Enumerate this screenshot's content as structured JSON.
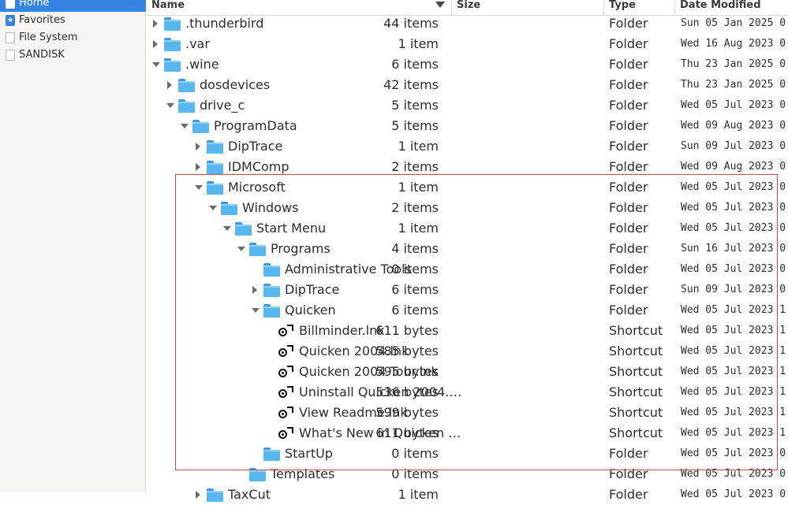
{
  "sidebar": {
    "items": [
      {
        "label": "Home",
        "icon": "home-icon",
        "selected": true
      },
      {
        "label": "Favorites",
        "icon": "star-icon",
        "selected": false
      },
      {
        "label": "File System",
        "icon": "drive-icon",
        "selected": false
      },
      {
        "label": "SANDISK",
        "icon": "drive-icon",
        "selected": false
      }
    ]
  },
  "columns": {
    "name": "Name",
    "size": "Size",
    "type": "Type",
    "date": "Date Modified"
  },
  "rows": [
    {
      "name": ".thunderbird",
      "size": "44 items",
      "type": "Folder",
      "date": "Sun 05 Jan 2025 0",
      "depth": 0,
      "expander": "collapsed",
      "icon": "folder-icon"
    },
    {
      "name": ".var",
      "size": "1 item",
      "type": "Folder",
      "date": "Wed 16 Aug 2023 0",
      "depth": 0,
      "expander": "collapsed",
      "icon": "folder-icon"
    },
    {
      "name": ".wine",
      "size": "6 items",
      "type": "Folder",
      "date": "Thu 23 Jan 2025 0",
      "depth": 0,
      "expander": "expanded",
      "icon": "folder-icon"
    },
    {
      "name": "dosdevices",
      "size": "42 items",
      "type": "Folder",
      "date": "Thu 23 Jan 2025 0",
      "depth": 1,
      "expander": "collapsed",
      "icon": "folder-icon"
    },
    {
      "name": "drive_c",
      "size": "5 items",
      "type": "Folder",
      "date": "Wed 05 Jul 2023 0",
      "depth": 1,
      "expander": "expanded",
      "icon": "folder-icon"
    },
    {
      "name": "ProgramData",
      "size": "5 items",
      "type": "Folder",
      "date": "Wed 09 Aug 2023 0",
      "depth": 2,
      "expander": "expanded",
      "icon": "folder-icon"
    },
    {
      "name": "DipTrace",
      "size": "1 item",
      "type": "Folder",
      "date": "Sun 09 Jul 2023 0",
      "depth": 3,
      "expander": "collapsed",
      "icon": "folder-icon"
    },
    {
      "name": "IDMComp",
      "size": "2 items",
      "type": "Folder",
      "date": "Wed 09 Aug 2023 0",
      "depth": 3,
      "expander": "collapsed",
      "icon": "folder-icon"
    },
    {
      "name": "Microsoft",
      "size": "1 item",
      "type": "Folder",
      "date": "Wed 05 Jul 2023 0",
      "depth": 3,
      "expander": "expanded",
      "icon": "folder-icon"
    },
    {
      "name": "Windows",
      "size": "2 items",
      "type": "Folder",
      "date": "Wed 05 Jul 2023 0",
      "depth": 4,
      "expander": "expanded",
      "icon": "folder-icon"
    },
    {
      "name": "Start Menu",
      "size": "1 item",
      "type": "Folder",
      "date": "Wed 05 Jul 2023 0",
      "depth": 5,
      "expander": "expanded",
      "icon": "folder-icon"
    },
    {
      "name": "Programs",
      "size": "4 items",
      "type": "Folder",
      "date": "Sun 16 Jul 2023 0",
      "depth": 6,
      "expander": "expanded",
      "icon": "folder-icon"
    },
    {
      "name": "Administrative Tools",
      "size": "0 items",
      "type": "Folder",
      "date": "Wed 05 Jul 2023 0",
      "depth": 7,
      "expander": "none",
      "icon": "folder-icon"
    },
    {
      "name": "DipTrace",
      "size": "6 items",
      "type": "Folder",
      "date": "Sun 09 Jul 2023 0",
      "depth": 7,
      "expander": "collapsed",
      "icon": "folder-icon"
    },
    {
      "name": "Quicken",
      "size": "6 items",
      "type": "Folder",
      "date": "Wed 05 Jul 2023 1",
      "depth": 7,
      "expander": "expanded",
      "icon": "folder-icon"
    },
    {
      "name": "Billminder.lnk",
      "size": "611 bytes",
      "type": "Shortcut",
      "date": "Wed 05 Jul 2023 1",
      "depth": 8,
      "expander": "none",
      "icon": "shortcut-icon"
    },
    {
      "name": "Quicken 2004.lnk",
      "size": "585 bytes",
      "type": "Shortcut",
      "date": "Wed 05 Jul 2023 1",
      "depth": 8,
      "expander": "none",
      "icon": "shortcut-icon"
    },
    {
      "name": "Quicken 2004 Tour.lnk",
      "size": "595 bytes",
      "type": "Shortcut",
      "date": "Wed 05 Jul 2023 1",
      "depth": 8,
      "expander": "none",
      "icon": "shortcut-icon"
    },
    {
      "name": "Uninstall Quicken 2004.…",
      "size": "536 bytes",
      "type": "Shortcut",
      "date": "Wed 05 Jul 2023 1",
      "depth": 8,
      "expander": "none",
      "icon": "shortcut-icon"
    },
    {
      "name": "View Readme.lnk",
      "size": "599 bytes",
      "type": "Shortcut",
      "date": "Wed 05 Jul 2023 1",
      "depth": 8,
      "expander": "none",
      "icon": "shortcut-icon"
    },
    {
      "name": "What's New in Quicken …",
      "size": "611 bytes",
      "type": "Shortcut",
      "date": "Wed 05 Jul 2023 1",
      "depth": 8,
      "expander": "none",
      "icon": "shortcut-icon"
    },
    {
      "name": "StartUp",
      "size": "0 items",
      "type": "Folder",
      "date": "Wed 05 Jul 2023 0",
      "depth": 7,
      "expander": "none",
      "icon": "folder-icon"
    },
    {
      "name": "Templates",
      "size": "0 items",
      "type": "Folder",
      "date": "Wed 05 Jul 2023 0",
      "depth": 6,
      "expander": "none",
      "icon": "folder-icon"
    },
    {
      "name": "TaxCut",
      "size": "1 item",
      "type": "Folder",
      "date": "Wed 05 Jul 2023 0",
      "depth": 3,
      "expander": "collapsed",
      "icon": "folder-icon"
    }
  ],
  "colors": {
    "selection": "#3584e4",
    "folder": "#59b7f0",
    "highlight_box": "#c7474f"
  }
}
